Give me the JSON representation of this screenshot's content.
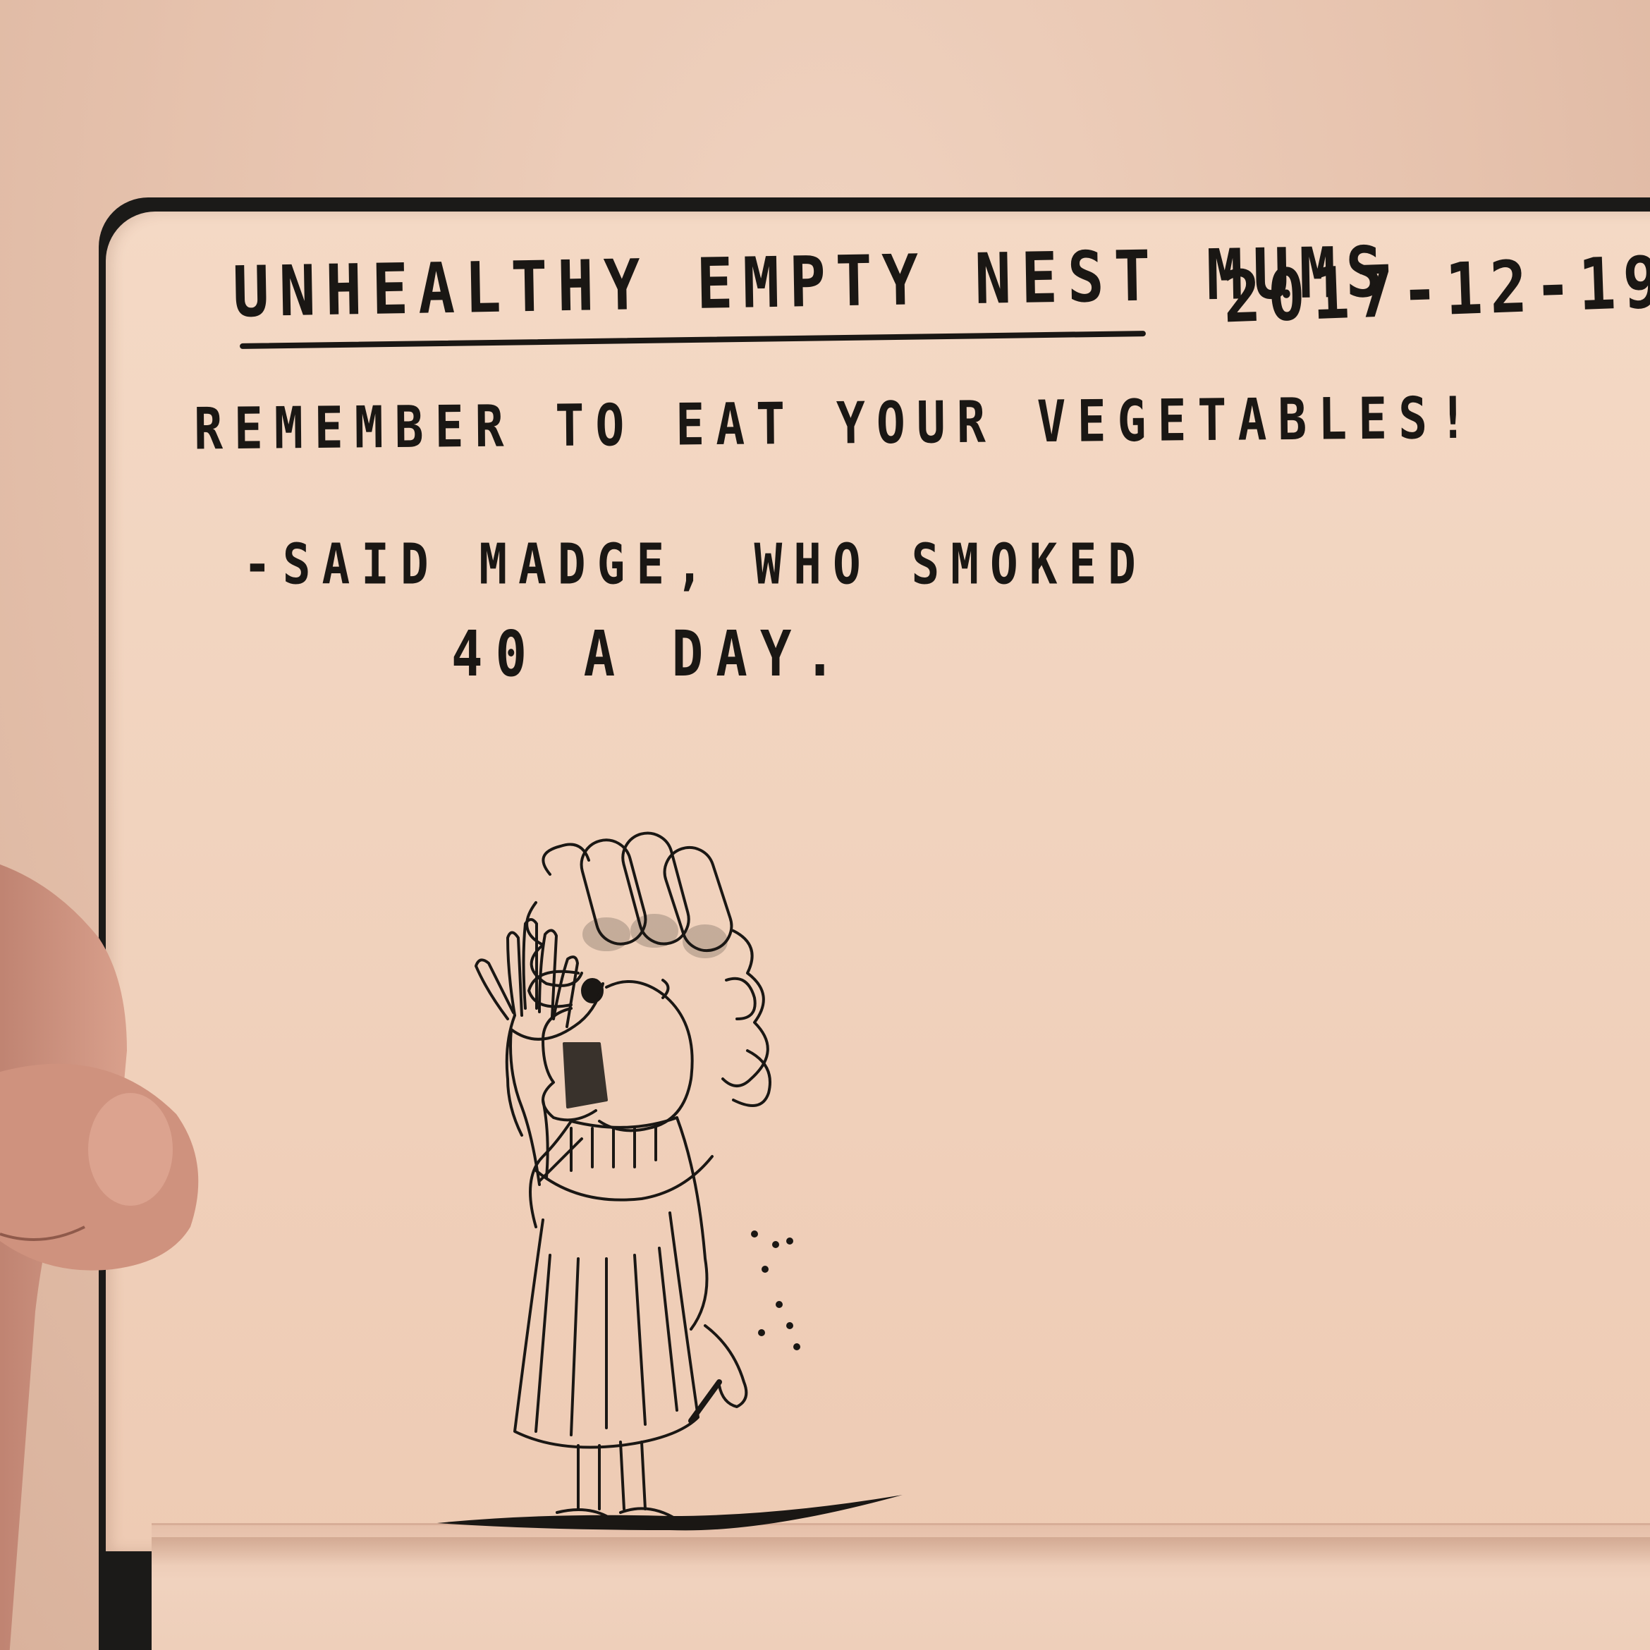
{
  "notebook": {
    "title": "UNHEALTHY EMPTY NEST MUMS",
    "date": "2017-12-19",
    "line1": "REMEMBER TO EAT YOUR VEGETABLES!",
    "line2": "-SAID MADGE, WHO SMOKED",
    "line3": "40 A DAY."
  },
  "colors": {
    "ink": "#1a1714",
    "paper": "#f1d3be",
    "cover": "#1b1a18",
    "skin": "#c98f7c"
  },
  "illustration": {
    "subject": "woman-with-hair-rollers-smoking-cigarette",
    "icon": "ink-sketch"
  }
}
